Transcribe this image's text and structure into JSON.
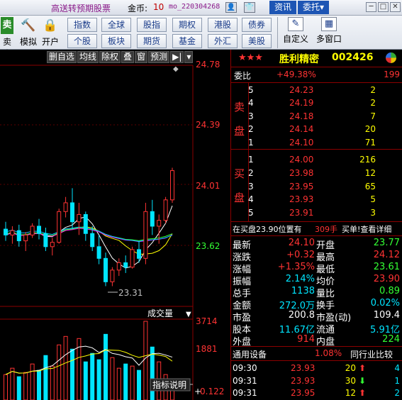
{
  "topbar": {
    "promo": "高送转预期股票",
    "coins_label": "金币:",
    "coins_value": "10",
    "username": "mo_220304268",
    "tab_info": "资讯",
    "tab_order": "委托",
    "tab_order_arrow": "▾"
  },
  "toolbar": {
    "sell": "卖出",
    "simulate": "模拟",
    "open": "开户",
    "nav": [
      "指数",
      "全球",
      "股指",
      "期权",
      "港股",
      "债券",
      "个股",
      "板块",
      "期货",
      "基金",
      "外汇",
      "美股"
    ],
    "custom": "自定义",
    "multi_window": "多窗口"
  },
  "chart": {
    "subtoolbar": [
      "删自选",
      "均线",
      "除权",
      "叠",
      "窗",
      "预测"
    ],
    "price_axis": [
      "24.78",
      "24.39",
      "24.01",
      "23.62"
    ],
    "low_label": "23.31",
    "volume_label": "成交量",
    "volume_axis": [
      "3714",
      "1881"
    ],
    "indicator_label": "指标说明",
    "indicator_value": "0.122"
  },
  "quote": {
    "stars": "★★★",
    "name": "胜利精密",
    "code": "002426",
    "webi_label": "委比",
    "webi_pct": "+49.38%",
    "webi_diff": "199",
    "sell_label": [
      "卖",
      "盘"
    ],
    "sells": [
      {
        "level": "5",
        "price": "24.23",
        "vol": "2"
      },
      {
        "level": "4",
        "price": "24.19",
        "vol": "2"
      },
      {
        "level": "3",
        "price": "24.18",
        "vol": "7"
      },
      {
        "level": "2",
        "price": "24.14",
        "vol": "20"
      },
      {
        "level": "1",
        "price": "24.10",
        "vol": "71"
      }
    ],
    "buy_label": [
      "买",
      "盘"
    ],
    "buys": [
      {
        "level": "1",
        "price": "24.00",
        "vol": "216"
      },
      {
        "level": "2",
        "price": "23.98",
        "vol": "12"
      },
      {
        "level": "3",
        "price": "23.95",
        "vol": "65"
      },
      {
        "level": "4",
        "price": "23.93",
        "vol": "5"
      },
      {
        "level": "5",
        "price": "23.91",
        "vol": "3"
      }
    ],
    "notice_main": "在买盘23.90位置有",
    "notice_vol": "309手",
    "notice_link": "买单!查看详细",
    "stats": [
      {
        "l1": "最新",
        "v1": "24.10",
        "c1": "red",
        "l2": "开盘",
        "v2": "23.77",
        "c2": "green"
      },
      {
        "l1": "涨跌",
        "v1": "+0.32",
        "c1": "red",
        "l2": "最高",
        "v2": "24.12",
        "c2": "red"
      },
      {
        "l1": "涨幅",
        "v1": "+1.35%",
        "c1": "red",
        "l2": "最低",
        "v2": "23.61",
        "c2": "green"
      },
      {
        "l1": "振幅",
        "v1": "2.14%",
        "c1": "cyan",
        "l2": "均价",
        "v2": "23.90",
        "c2": "red"
      },
      {
        "l1": "总手",
        "v1": "1138",
        "c1": "cyan",
        "l2": "量比",
        "v2": "0.89",
        "c2": "green"
      },
      {
        "l1": "金额",
        "v1": "272.0万",
        "c1": "cyan",
        "l2": "换手",
        "v2": "0.02%",
        "c2": "cyan"
      },
      {
        "l1": "市盈",
        "v1": "200.8",
        "c1": "white",
        "l2": "市盈(动)",
        "v2": "109.4",
        "c2": "white"
      },
      {
        "l1": "股本",
        "v1": "11.67亿",
        "c1": "cyan",
        "l2": "流通",
        "v2": "5.91亿",
        "c2": "cyan"
      },
      {
        "l1": "外盘",
        "v1": "914",
        "c1": "red",
        "l2": "内盘",
        "v2": "224",
        "c2": "green"
      }
    ],
    "sector_name": "通用设备",
    "sector_pct": "1.08%",
    "sector_compare": "同行业比较",
    "ticks": [
      {
        "time": "09:30",
        "price": "23.93",
        "vol": "20",
        "dir": "up",
        "n": "4"
      },
      {
        "time": "09:31",
        "price": "23.93",
        "vol": "30",
        "dir": "down",
        "n": "1"
      },
      {
        "time": "09:31",
        "price": "23.95",
        "vol": "12",
        "dir": "up",
        "n": "2"
      }
    ]
  },
  "chart_data": {
    "type": "candlestick",
    "price_ylim": [
      23.23,
      24.83
    ],
    "volume_ylim": [
      0,
      3714
    ],
    "candles": [
      {
        "o": 23.7,
        "h": 23.75,
        "l": 23.62,
        "c": 23.66
      },
      {
        "o": 23.66,
        "h": 23.72,
        "l": 23.6,
        "c": 23.69
      },
      {
        "o": 23.69,
        "h": 23.73,
        "l": 23.58,
        "c": 23.62
      },
      {
        "o": 23.62,
        "h": 23.68,
        "l": 23.55,
        "c": 23.66
      },
      {
        "o": 23.66,
        "h": 23.74,
        "l": 23.64,
        "c": 23.72
      },
      {
        "o": 23.72,
        "h": 23.77,
        "l": 23.63,
        "c": 23.67
      },
      {
        "o": 23.67,
        "h": 23.71,
        "l": 23.55,
        "c": 23.58
      },
      {
        "o": 23.58,
        "h": 23.64,
        "l": 23.52,
        "c": 23.61
      },
      {
        "o": 23.61,
        "h": 23.84,
        "l": 23.6,
        "c": 23.82
      },
      {
        "o": 23.82,
        "h": 23.92,
        "l": 23.78,
        "c": 23.88
      },
      {
        "o": 23.88,
        "h": 23.98,
        "l": 23.7,
        "c": 23.75
      },
      {
        "o": 23.75,
        "h": 23.88,
        "l": 23.66,
        "c": 23.8
      },
      {
        "o": 23.8,
        "h": 23.82,
        "l": 23.62,
        "c": 23.67
      },
      {
        "o": 23.67,
        "h": 23.72,
        "l": 23.55,
        "c": 23.58
      },
      {
        "o": 23.58,
        "h": 23.66,
        "l": 23.46,
        "c": 23.5
      },
      {
        "o": 23.5,
        "h": 23.54,
        "l": 23.31,
        "c": 23.34
      },
      {
        "o": 23.34,
        "h": 23.44,
        "l": 23.31,
        "c": 23.42
      },
      {
        "o": 23.42,
        "h": 23.5,
        "l": 23.38,
        "c": 23.47
      },
      {
        "o": 23.47,
        "h": 23.52,
        "l": 23.4,
        "c": 23.44
      },
      {
        "o": 23.44,
        "h": 23.58,
        "l": 23.43,
        "c": 23.56
      },
      {
        "o": 23.56,
        "h": 23.62,
        "l": 23.47,
        "c": 23.5
      },
      {
        "o": 23.5,
        "h": 23.88,
        "l": 23.46,
        "c": 23.82
      },
      {
        "o": 23.82,
        "h": 23.9,
        "l": 23.66,
        "c": 23.72
      },
      {
        "o": 23.72,
        "h": 23.8,
        "l": 23.6,
        "c": 23.76
      },
      {
        "o": 23.76,
        "h": 23.92,
        "l": 23.74,
        "c": 23.9
      },
      {
        "o": 23.9,
        "h": 24.12,
        "l": 23.88,
        "c": 24.1
      }
    ],
    "volumes": [
      1200,
      1500,
      1100,
      1300,
      1700,
      1400,
      2100,
      1600,
      2600,
      3000,
      2400,
      2900,
      1800,
      2200,
      1900,
      3100,
      2000,
      1500,
      1700,
      1600,
      1400,
      3714,
      2500,
      1800,
      1200,
      900
    ],
    "volume_up": [
      true,
      true,
      false,
      true,
      true,
      false,
      false,
      true,
      true,
      true,
      false,
      true,
      false,
      false,
      false,
      false,
      true,
      true,
      false,
      true,
      false,
      true,
      false,
      true,
      true,
      true
    ]
  }
}
